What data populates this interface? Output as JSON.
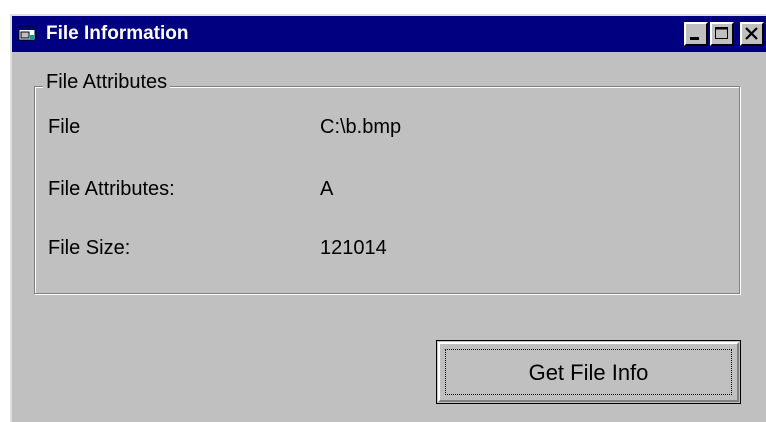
{
  "window": {
    "title": "File Information",
    "icon": "app-window-icon"
  },
  "titlebar_buttons": {
    "minimize": "minimize-icon",
    "maximize": "maximize-icon",
    "close": "close-icon"
  },
  "group": {
    "legend": "File Attributes",
    "rows": [
      {
        "label": "File",
        "value": "C:\\b.bmp"
      },
      {
        "label": "File Attributes:",
        "value": "A"
      },
      {
        "label": "File Size:",
        "value": "121014"
      }
    ]
  },
  "actions": {
    "get_info_label": "Get File Info"
  },
  "colors": {
    "titlebar": "#000080",
    "face": "#c0c0c0"
  }
}
